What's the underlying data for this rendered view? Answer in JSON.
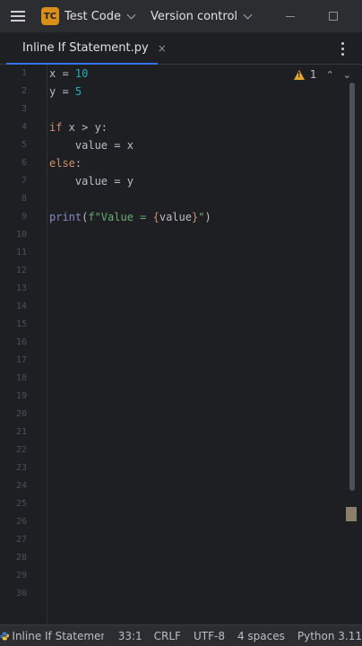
{
  "titlebar": {
    "project_badge": "TC",
    "project_name": "Test Code",
    "vcs_label": "Version control"
  },
  "tab": {
    "label": "Inline If Statement.py",
    "close": "×"
  },
  "editor": {
    "line_numbers": [
      "1",
      "2",
      "3",
      "4",
      "5",
      "6",
      "7",
      "8",
      "9",
      "10",
      "11",
      "12",
      "13",
      "14",
      "15",
      "16",
      "17",
      "18",
      "19",
      "20",
      "21",
      "22",
      "23",
      "24",
      "25",
      "26",
      "27",
      "28",
      "29",
      "30"
    ],
    "code": {
      "l1": {
        "var": "x = ",
        "num": "10"
      },
      "l2": {
        "var": "y = ",
        "num": "5"
      },
      "l4": {
        "kw": "if",
        "rest": " x > y:"
      },
      "l5": {
        "text": "    value = x"
      },
      "l6": {
        "kw": "else",
        "rest": ":"
      },
      "l7": {
        "text": "    value = y"
      },
      "l9": {
        "fn": "print",
        "open": "(",
        "str1": "f\"Value = ",
        "brace_open": "{",
        "var": "value",
        "brace_close": "}",
        "str2": "\"",
        "close": ")"
      }
    },
    "warnings": {
      "count": "1"
    }
  },
  "statusbar": {
    "file": "Inline If Statemen",
    "position": "33:1",
    "line_sep": "CRLF",
    "encoding": "UTF-8",
    "indent": "4 spaces",
    "interpreter": "Python 3.11"
  },
  "colors": {
    "accent": "#3574f0",
    "keyword": "#cf8e6d",
    "number": "#2aacb8",
    "builtin": "#8888c6",
    "string": "#6aab73",
    "warning": "#e0a83a"
  },
  "icons": [
    "hamburger-menu-icon",
    "chevron-down-icon",
    "minimize-icon",
    "maximize-icon",
    "python-icon",
    "close-icon",
    "more-vertical-icon",
    "warning-icon",
    "arrow-up-icon",
    "arrow-down-icon"
  ]
}
